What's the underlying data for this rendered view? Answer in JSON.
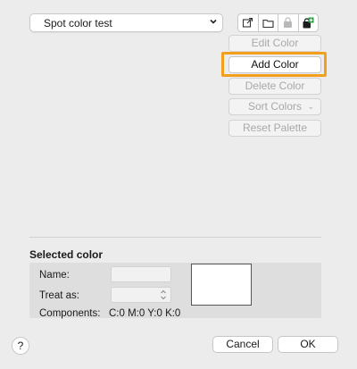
{
  "palette": {
    "selected": "Spot color test"
  },
  "toolbar": {
    "icons": [
      "export-icon",
      "folder-icon",
      "locked-palette-icon",
      "new-palette-icon"
    ],
    "accent_add": "#21a038"
  },
  "actions": {
    "edit_color": "Edit Color",
    "add_color": "Add Color",
    "delete_color": "Delete Color",
    "sort_colors": "Sort Colors",
    "reset_palette": "Reset Palette",
    "highlight_color": "#f29f1c"
  },
  "selected_color": {
    "title": "Selected color",
    "name_label": "Name:",
    "name_value": "",
    "treat_as_label": "Treat as:",
    "treat_as_value": "",
    "components_label": "Components:",
    "components_value": "C:0 M:0 Y:0 K:0",
    "swatch_color": "#ffffff"
  },
  "footer": {
    "help": "?",
    "cancel": "Cancel",
    "ok": "OK"
  }
}
